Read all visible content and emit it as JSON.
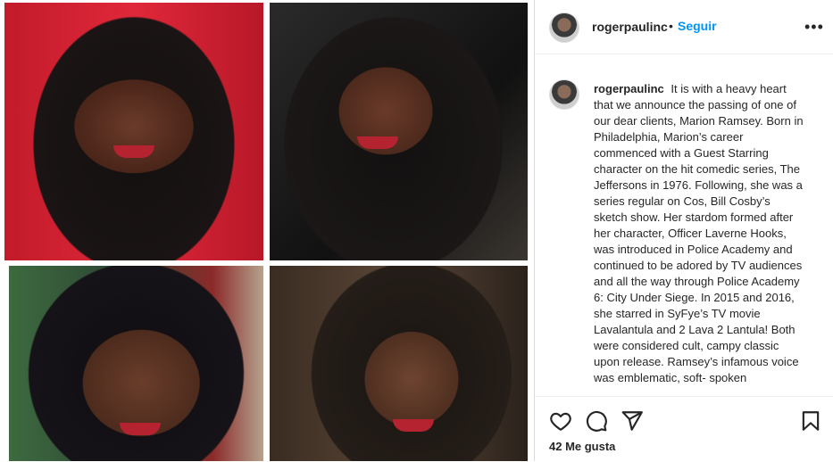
{
  "post": {
    "photos": [
      {
        "name": "photo-top-left"
      },
      {
        "name": "photo-top-right"
      },
      {
        "name": "photo-bottom-left"
      },
      {
        "name": "photo-bottom-right"
      }
    ]
  },
  "header": {
    "username": "rogerpaulinc",
    "separator": "•",
    "follow_label": "Seguir",
    "more_label": "•••"
  },
  "caption": {
    "username": "rogerpaulinc",
    "text": "It is with a heavy heart that we announce the passing of one of our dear clients, Marion Ramsey. Born in Philadelphia, Marion’s career commenced with a Guest Starring character on the hit comedic series, The Jeffersons in 1976. Following, she was a series regular on Cos, Bill Cosby’s sketch show. Her stardom formed after her character, Officer Laverne Hooks, was introduced in Police Academy and continued to be adored by TV audiences and all the way through Police Academy 6: City Under Siege. In 2015 and 2016, she starred in SyFye’s TV movie Lavalantula and 2 Lava 2 Lantula! Both were considered cult, campy classic upon release. Ramsey’s infamous voice was emblematic, soft- spoken"
  },
  "actions": {
    "icons": [
      "heart-icon",
      "comment-icon",
      "share-icon",
      "bookmark-icon"
    ],
    "likes_text": "42 Me gusta"
  },
  "colors": {
    "accent": "#0095f6",
    "text": "#262626",
    "border": "#dbdbdb"
  }
}
